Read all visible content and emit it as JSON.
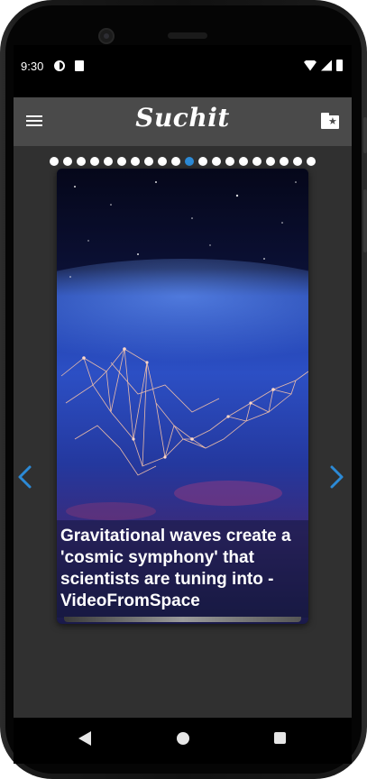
{
  "status_bar": {
    "time": "9:30"
  },
  "app_bar": {
    "title": "Suchit",
    "menu_icon": "menu-icon",
    "bookmark_folder_icon": "folder-star-icon"
  },
  "carousel": {
    "page_count": 20,
    "active_index": 10,
    "colors": {
      "dot": "#ffffff",
      "active_dot": "#2c8ad6",
      "background": "#303030",
      "app_bar": "#4a4a4a"
    },
    "prev_icon": "chevron-left-icon",
    "next_icon": "chevron-right-icon",
    "card": {
      "title": "Gravitational waves create a 'cosmic symphony' that scientists are tuning into - VideoFromSpace"
    }
  },
  "nav_bar": {
    "back_icon": "back-triangle-icon",
    "home_icon": "home-circle-icon",
    "recent_icon": "recents-square-icon"
  }
}
